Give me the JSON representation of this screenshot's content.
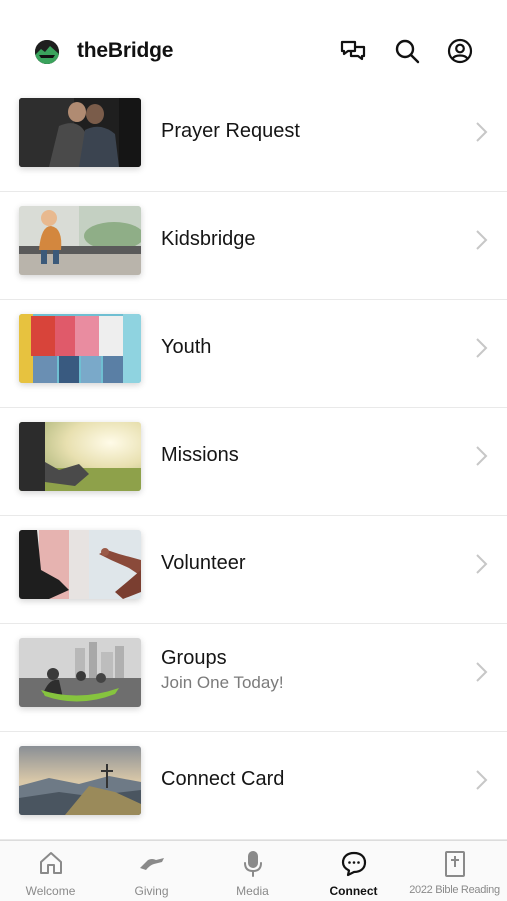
{
  "header": {
    "app_title": "theBridge",
    "icons": [
      "chat-icon",
      "search-icon",
      "profile-icon"
    ]
  },
  "items": [
    {
      "title": "Prayer Request",
      "subtitle": "",
      "image": "two men praying"
    },
    {
      "title": "Kidsbridge",
      "subtitle": "",
      "image": "child on a park bench"
    },
    {
      "title": "Youth",
      "subtitle": "",
      "image": "teens with phones against wall"
    },
    {
      "title": "Missions",
      "subtitle": "",
      "image": "person walking in sunny field"
    },
    {
      "title": "Volunteer",
      "subtitle": "",
      "image": "hands reaching across wall"
    },
    {
      "title": "Groups",
      "subtitle": "Join One Today!",
      "image": "group in hammock by city"
    },
    {
      "title": "Connect Card",
      "subtitle": "",
      "image": "cross on mountain top"
    }
  ],
  "tabs": [
    {
      "label": "Welcome",
      "icon": "home-icon",
      "active": false
    },
    {
      "label": "Giving",
      "icon": "giving-icon",
      "active": false
    },
    {
      "label": "Media",
      "icon": "microphone-icon",
      "active": false
    },
    {
      "label": "Connect",
      "icon": "chat-bubble-icon",
      "active": true
    },
    {
      "label": "2022 Bible Reading",
      "icon": "bible-icon",
      "active": false
    }
  ],
  "colors": {
    "tab_active": "#111111",
    "tab_inactive": "#8a8a8a",
    "divider": "#e9e9e9",
    "subtitle": "#7b7b7b"
  }
}
